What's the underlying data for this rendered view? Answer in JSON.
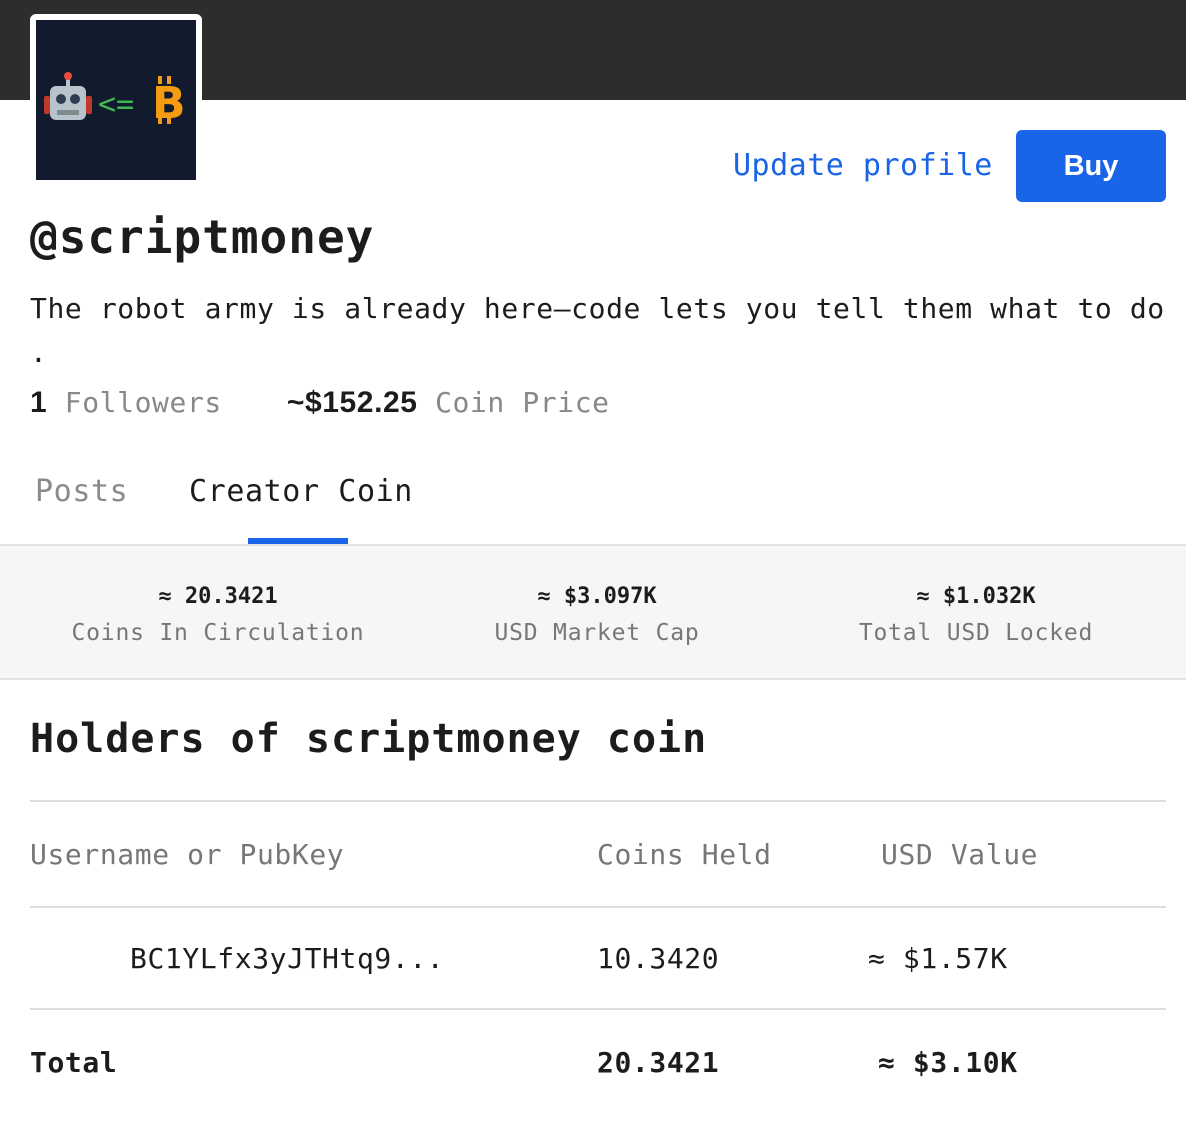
{
  "profile": {
    "username": "@scriptmoney",
    "bio": "The robot army is already here—code lets you tell them what to do .",
    "followers_count": "1",
    "followers_label": "Followers",
    "coin_price": "~$152.25",
    "coin_price_label": "Coin Price",
    "avatar_icon": "robot-lte-bitcoin-icon"
  },
  "actions": {
    "update_profile": "Update profile",
    "buy": "Buy"
  },
  "tabs": [
    {
      "label": "Posts",
      "active": false
    },
    {
      "label": "Creator Coin",
      "active": true
    }
  ],
  "summary": [
    {
      "value": "≈ 20.3421",
      "label": "Coins In Circulation"
    },
    {
      "value": "≈ $3.097K",
      "label": "USD Market Cap"
    },
    {
      "value": "≈ $1.032K",
      "label": "Total USD Locked"
    }
  ],
  "holders": {
    "title": "Holders of scriptmoney coin",
    "columns": [
      "Username or PubKey",
      "Coins Held",
      "USD Value"
    ],
    "rows": [
      {
        "user": "BC1YLfx3yJTHtq9...",
        "coins": "10.3420",
        "usd": "≈ $1.57K"
      }
    ],
    "total": {
      "label": "Total",
      "coins": "20.3421",
      "usd": "≈ $3.10K"
    }
  },
  "colors": {
    "accent": "#1a64e8",
    "banner": "#2d2d2d",
    "avatar_bg": "#121a2d"
  }
}
